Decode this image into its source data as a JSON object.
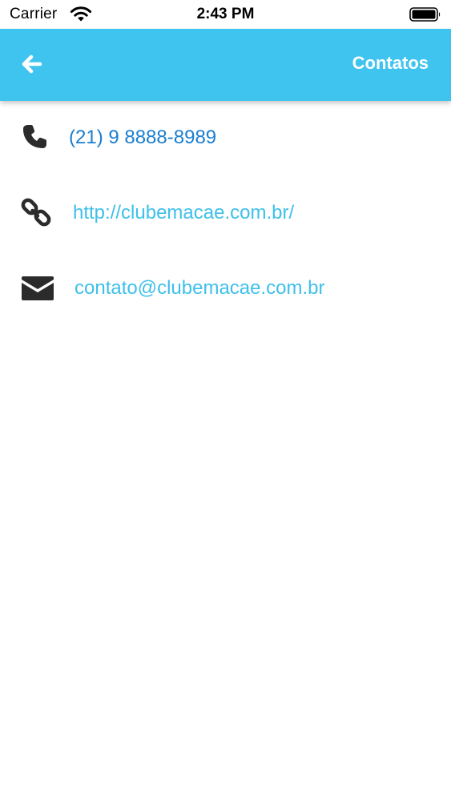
{
  "status_bar": {
    "carrier": "Carrier",
    "time": "2:43 PM"
  },
  "header": {
    "title": "Contatos",
    "back_icon": "arrow-left-icon",
    "background_color": "#3fc4f0"
  },
  "contacts": [
    {
      "icon": "phone-icon",
      "value": "(21) 9 8888-8989",
      "color": "#1a7ecf"
    },
    {
      "icon": "link-icon",
      "value": "http://clubemacae.com.br/",
      "color": "#3ec0ea"
    },
    {
      "icon": "envelope-icon",
      "value": "contato@clubemacae.com.br",
      "color": "#3ec0ea"
    }
  ]
}
